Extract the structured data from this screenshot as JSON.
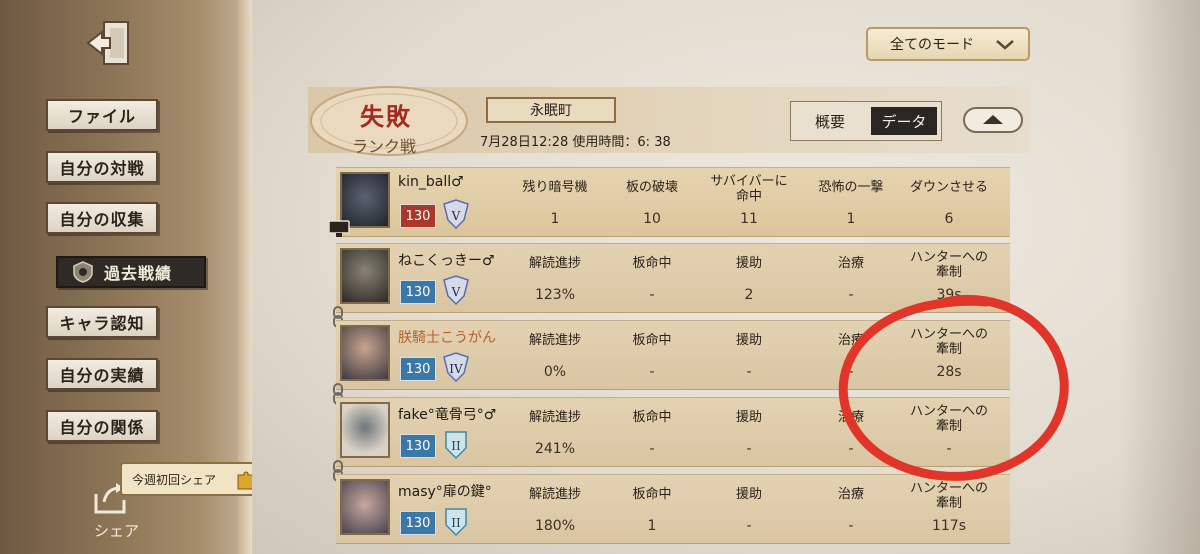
{
  "sidebar": {
    "exit_icon": "exit-door-icon",
    "items": [
      {
        "label": "ファイル",
        "active": false
      },
      {
        "label": "自分の対戦",
        "active": false
      },
      {
        "label": "自分の収集",
        "active": false
      },
      {
        "label": "過去戦績",
        "active": true,
        "icon": "badge-icon"
      },
      {
        "label": "キャラ認知",
        "active": false
      },
      {
        "label": "自分の実績",
        "active": false
      },
      {
        "label": "自分の関係",
        "active": false
      }
    ],
    "share_box_label": "今週初回シェア",
    "share_label": "シェア"
  },
  "mode_filter": {
    "label": "全てのモード"
  },
  "match": {
    "result": "失敗",
    "mode": "ランク戦",
    "map": "永眠町",
    "date_time": "7月28日12:28 使用時間：6: 38",
    "tabs": {
      "summary": "概要",
      "data": "データ",
      "selected": "data"
    }
  },
  "players": [
    {
      "name": "kin_ball♂",
      "level": "130",
      "rank": "V",
      "name_color": "normal",
      "stats": [
        {
          "label": "残り暗号機",
          "value": "1"
        },
        {
          "label": "板の破壊",
          "value": "10"
        },
        {
          "label": "サバイバーに\n命中",
          "value": "11"
        },
        {
          "label": "恐怖の一撃",
          "value": "1"
        },
        {
          "label": "ダウンさせる",
          "value": "6"
        }
      ]
    },
    {
      "name": "ねこくっきー♂",
      "level": "130",
      "rank": "V",
      "name_color": "normal",
      "stats": [
        {
          "label": "解読進捗",
          "value": "123%"
        },
        {
          "label": "板命中",
          "value": "-"
        },
        {
          "label": "援助",
          "value": "2"
        },
        {
          "label": "治療",
          "value": "-"
        },
        {
          "label": "ハンターへの\n牽制",
          "value": "39s"
        }
      ]
    },
    {
      "name": "朕騎士こうがん",
      "level": "130",
      "rank": "IV",
      "name_color": "orange",
      "stats": [
        {
          "label": "解読進捗",
          "value": "0%"
        },
        {
          "label": "板命中",
          "value": "-"
        },
        {
          "label": "援助",
          "value": "-"
        },
        {
          "label": "治療",
          "value": "-"
        },
        {
          "label": "ハンターへの\n牽制",
          "value": "28s"
        }
      ]
    },
    {
      "name": "fake°竜骨弓°♂",
      "level": "130",
      "rank": "II",
      "name_color": "normal",
      "stats": [
        {
          "label": "解読進捗",
          "value": "241%"
        },
        {
          "label": "板命中",
          "value": "-"
        },
        {
          "label": "援助",
          "value": "-"
        },
        {
          "label": "治療",
          "value": "-"
        },
        {
          "label": "ハンターへの\n牽制",
          "value": "-"
        }
      ]
    },
    {
      "name": "masy°扉の鍵°",
      "level": "130",
      "rank": "II",
      "name_color": "normal",
      "stats": [
        {
          "label": "解読進捗",
          "value": "180%"
        },
        {
          "label": "板命中",
          "value": "1"
        },
        {
          "label": "援助",
          "value": "-"
        },
        {
          "label": "治療",
          "value": "-"
        },
        {
          "label": "ハンターへの\n牽制",
          "value": "117s"
        }
      ]
    }
  ],
  "colors": {
    "result_red": "#a32a1e",
    "level_hunter": "#a8392a",
    "level_survivor": "#3a78a8",
    "annotation": "#e03528"
  }
}
